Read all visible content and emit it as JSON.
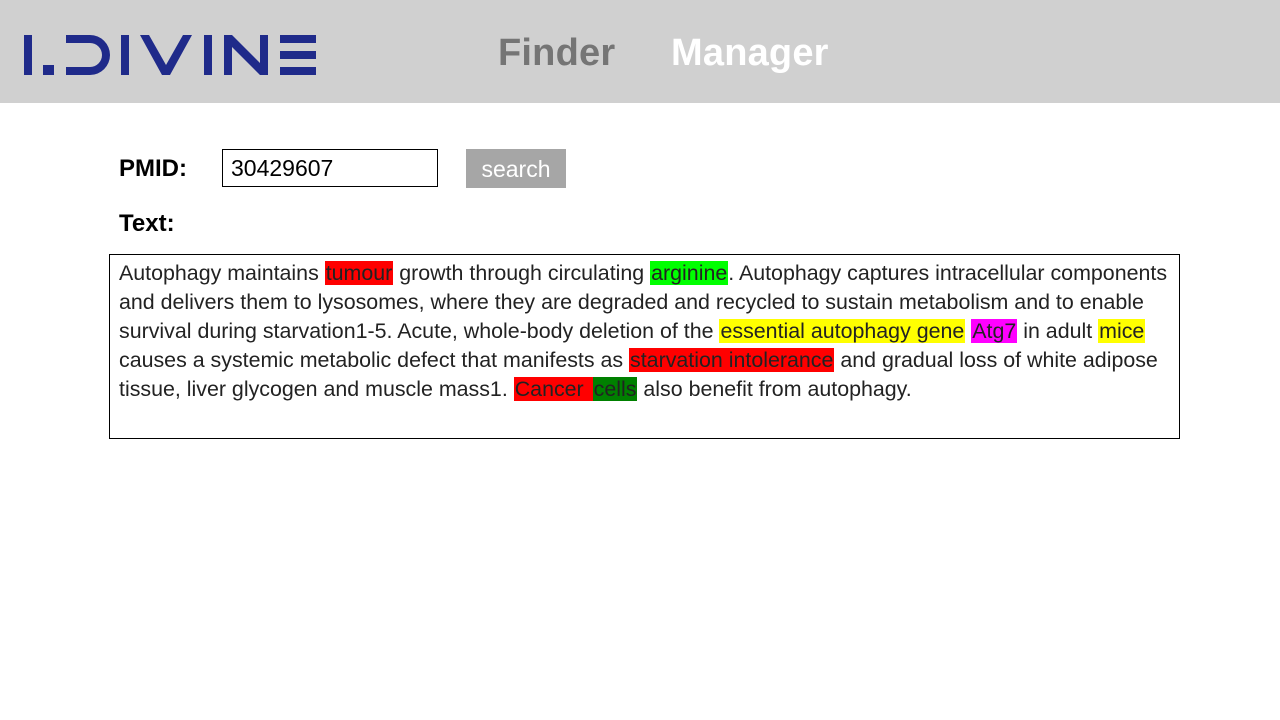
{
  "header": {
    "logo_text": "I.DIVINE",
    "logo_color": "#1f2a8a",
    "nav": {
      "finder_label": "Finder",
      "manager_label": "Manager"
    }
  },
  "search": {
    "pmid_label": "PMID:",
    "pmid_value": "30429607",
    "button_label": "search"
  },
  "text_section": {
    "label": "Text:",
    "segments": [
      {
        "text": "Autophagy maintains ",
        "highlight": null
      },
      {
        "text": "tumour",
        "highlight": "red"
      },
      {
        "text": " growth through circulating ",
        "highlight": null
      },
      {
        "text": "arginine",
        "highlight": "green"
      },
      {
        "text": ". Autophagy captures intracellular components and delivers them to lysosomes, where they are degraded and recycled to sustain metabolism and to enable survival during starvation1-5. Acute, whole-body deletion of the ",
        "highlight": null
      },
      {
        "text": "essential autophagy gene",
        "highlight": "yellow"
      },
      {
        "text": " ",
        "highlight": null
      },
      {
        "text": "Atg7",
        "highlight": "magenta"
      },
      {
        "text": " in adult ",
        "highlight": null
      },
      {
        "text": "mice",
        "highlight": "yellow"
      },
      {
        "text": " causes a systemic metabolic defect that manifests as ",
        "highlight": null
      },
      {
        "text": "starvation intolerance",
        "highlight": "red"
      },
      {
        "text": " and gradual loss of white adipose tissue, liver glycogen and muscle mass1. ",
        "highlight": null
      },
      {
        "text": "Cancer",
        "highlight": "red"
      },
      {
        "text": " ",
        "highlight": "red"
      },
      {
        "text": "cells",
        "highlight": "darkgreen"
      },
      {
        "text": " also benefit from autophagy.",
        "highlight": null
      }
    ]
  },
  "colors": {
    "header_bg": "#d0d0d0",
    "nav_inactive": "#757575",
    "nav_active": "#ffffff",
    "button_bg": "#a6a6a6",
    "highlight_red": "#ff0000",
    "highlight_green": "#00ff00",
    "highlight_yellow": "#ffff00",
    "highlight_magenta": "#ff00ff",
    "highlight_darkgreen": "#008000"
  }
}
